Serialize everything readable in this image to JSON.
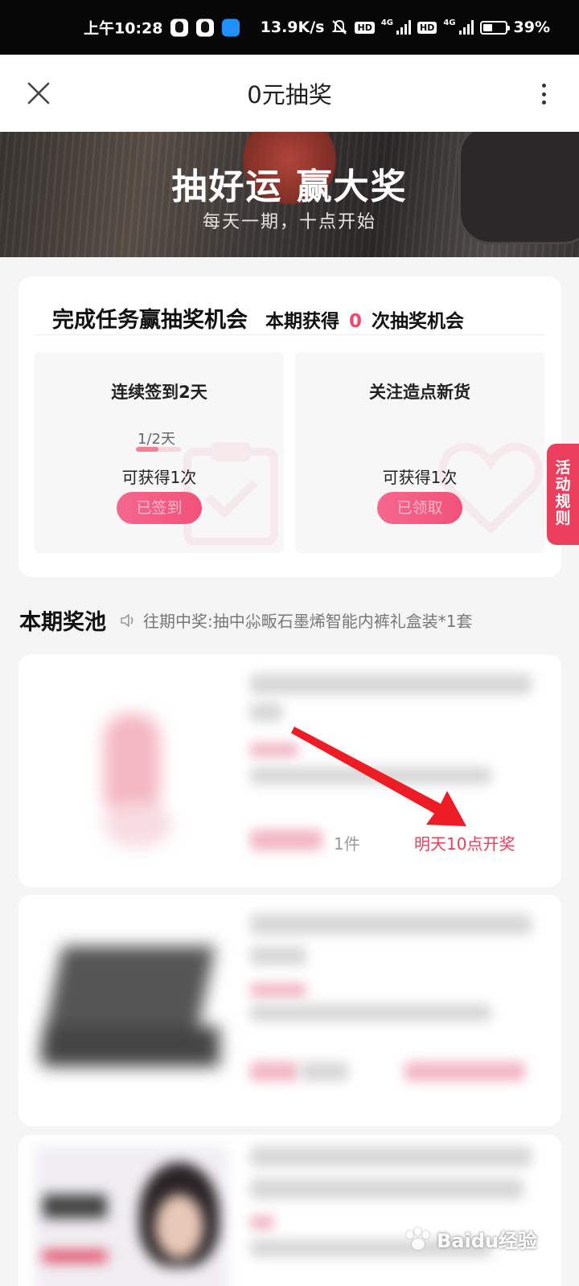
{
  "status_bar": {
    "time": "上午10:28",
    "speed": "13.9K/s",
    "hd1": "HD",
    "net1": "4G",
    "hd2": "HD",
    "net2": "4G",
    "battery": "39%",
    "icons": [
      "qq-icon",
      "qq-icon",
      "app-icon",
      "mute-bell-icon",
      "signal-icon",
      "battery-icon"
    ]
  },
  "nav": {
    "title": "0元抽奖",
    "close_icon": "close-icon",
    "more_icon": "more-vertical-icon"
  },
  "banner": {
    "title": "抽好运 赢大奖",
    "subtitle": "每天一期，十点开始"
  },
  "task_card": {
    "title": "完成任务赢抽奖机会",
    "chances_prefix": "本期获得",
    "chances_count": "0",
    "chances_suffix": "次抽奖机会",
    "tasks": [
      {
        "title": "连续签到2天",
        "progress_text": "1/2天",
        "progress_fraction": 0.5,
        "reward": "可获得1次",
        "button": "已签到",
        "icon": "clipboard-check-icon"
      },
      {
        "title": "关注造点新货",
        "reward": "可获得1次",
        "button": "已领取",
        "icon": "heart-icon"
      }
    ]
  },
  "rules_tab": {
    "label": "活动规则"
  },
  "prize_pool": {
    "title": "本期奖池",
    "news_icon": "speaker-icon",
    "news": "往期中奖:抽中尛畈石墨烯智能内裤礼盒装*1套"
  },
  "prizes": [
    {
      "quantity": "1件",
      "draw_time": "明天10点开奖"
    }
  ],
  "watermark": "Baidu经验",
  "colors": {
    "accent": "#ef4a6a",
    "button": "#f2527a",
    "rules_tab": "#ec3f5d",
    "background": "#f5f5f5"
  }
}
